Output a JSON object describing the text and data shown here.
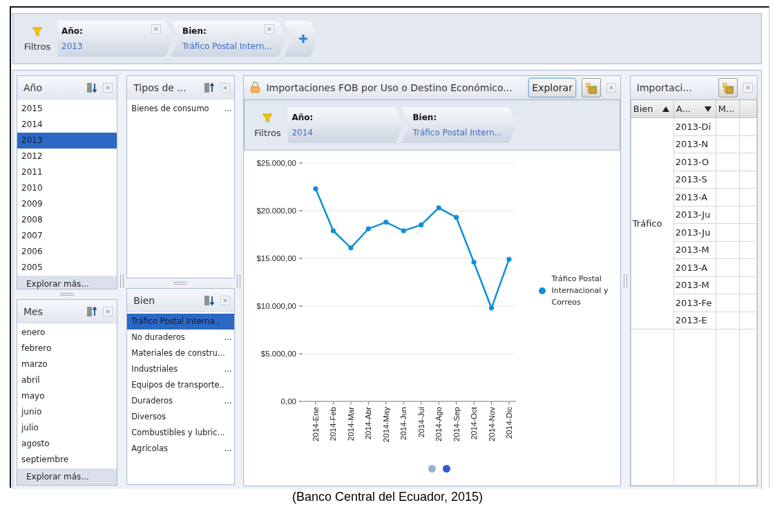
{
  "filter_bar": {
    "label": "Filtros",
    "chips": [
      {
        "label": "Año:",
        "value": "2013"
      },
      {
        "label": "Bien:",
        "value": "Tráfico Postal Intern..."
      }
    ]
  },
  "year_panel": {
    "title": "Año",
    "sort_descending": true,
    "more": "Explorar más...",
    "items": [
      {
        "label": "2015",
        "selected": false
      },
      {
        "label": "2014",
        "selected": false
      },
      {
        "label": "2013",
        "selected": true
      },
      {
        "label": "2012",
        "selected": false
      },
      {
        "label": "2011",
        "selected": false
      },
      {
        "label": "2010",
        "selected": false
      },
      {
        "label": "2009",
        "selected": false
      },
      {
        "label": "2008",
        "selected": false
      },
      {
        "label": "2007",
        "selected": false
      },
      {
        "label": "2006",
        "selected": false
      },
      {
        "label": "2005",
        "selected": false
      }
    ]
  },
  "month_panel": {
    "title": "Mes",
    "sort_descending": false,
    "more": "Explorar más...",
    "items": [
      {
        "label": "enero",
        "selected": false
      },
      {
        "label": "febrero",
        "selected": false
      },
      {
        "label": "marzo",
        "selected": false
      },
      {
        "label": "abril",
        "selected": false
      },
      {
        "label": "mayo",
        "selected": false
      },
      {
        "label": "junio",
        "selected": false
      },
      {
        "label": "julio",
        "selected": false
      },
      {
        "label": "agosto",
        "selected": false
      },
      {
        "label": "septiembre",
        "selected": false
      }
    ]
  },
  "type_panel": {
    "title": "Tipos de ...",
    "sort_descending": false,
    "items": [
      {
        "label": "Bienes de consumo",
        "suffix": "...",
        "selected": false
      }
    ]
  },
  "goods_panel": {
    "title": "Bien",
    "sort_descending": true,
    "items": [
      {
        "label": "Tráfico Postal Interna..",
        "selected": true
      },
      {
        "label": "No duraderos",
        "suffix": "...",
        "selected": false
      },
      {
        "label": "Materiales de constru...",
        "selected": false
      },
      {
        "label": "Industriales",
        "suffix": "...",
        "selected": false
      },
      {
        "label": "Equipos de transporte..",
        "selected": false
      },
      {
        "label": "Duraderos",
        "suffix": "...",
        "selected": false
      },
      {
        "label": "Diversos",
        "selected": false
      },
      {
        "label": "Combustibles y lubric...",
        "selected": false
      },
      {
        "label": "Agrícolas",
        "suffix": "...",
        "selected": false
      }
    ]
  },
  "chart_panel": {
    "title": "Importaciones FOB por Uso o Destino Económico...",
    "explore_button": "Explorar",
    "filters": {
      "label": "Filtros",
      "chips": [
        {
          "label": "Año:",
          "value": "2014"
        },
        {
          "label": "Bien:",
          "value": "Tráfico Postal Intern..."
        }
      ]
    },
    "chart_data": {
      "type": "line",
      "categories": [
        "2014-Ene",
        "2014-Feb",
        "2014-Mar",
        "2014-Abr",
        "2014-May",
        "2014-Jun",
        "2014-Jul",
        "2014-Ago",
        "2014-Sep",
        "2014-Oct",
        "2014-Nov",
        "2014-Dic"
      ],
      "grid": true,
      "series": [
        {
          "name": "Tráfico Postal Internacional y Correos",
          "color": "#0f8fd6",
          "marker": true,
          "values": [
            22300,
            17900,
            16100,
            18100,
            18800,
            17900,
            18500,
            20300,
            19300,
            14600,
            9800,
            14900
          ]
        }
      ],
      "ylim": [
        0,
        25000
      ],
      "yticks": [
        {
          "value": 0,
          "label": "0,00"
        },
        {
          "value": 5000,
          "label": "$5.000,00"
        },
        {
          "value": 10000,
          "label": "$10.000,00"
        },
        {
          "value": 15000,
          "label": "$15.000,00"
        },
        {
          "value": 20000,
          "label": "$20.000,00"
        },
        {
          "value": 25000,
          "label": "$25.000,00"
        }
      ]
    },
    "pages": [
      {
        "selected": false
      },
      {
        "selected": true
      }
    ]
  },
  "table_panel": {
    "title": "Importaci...",
    "columns": [
      {
        "label": "Bien",
        "sort_descending": false
      },
      {
        "label": "A...",
        "sort_descending": true
      },
      {
        "label": "M..."
      }
    ],
    "group": "Tráfico",
    "rows": [
      "2013-Di",
      "2013-N",
      "2013-O",
      "2013-S",
      "2013-A",
      "2013-Ju",
      "2013-Ju",
      "2013-M",
      "2013-A",
      "2013-M",
      "2013-Fe",
      "2013-E"
    ]
  },
  "caption": "(Banco Central del Ecuador, 2015)"
}
